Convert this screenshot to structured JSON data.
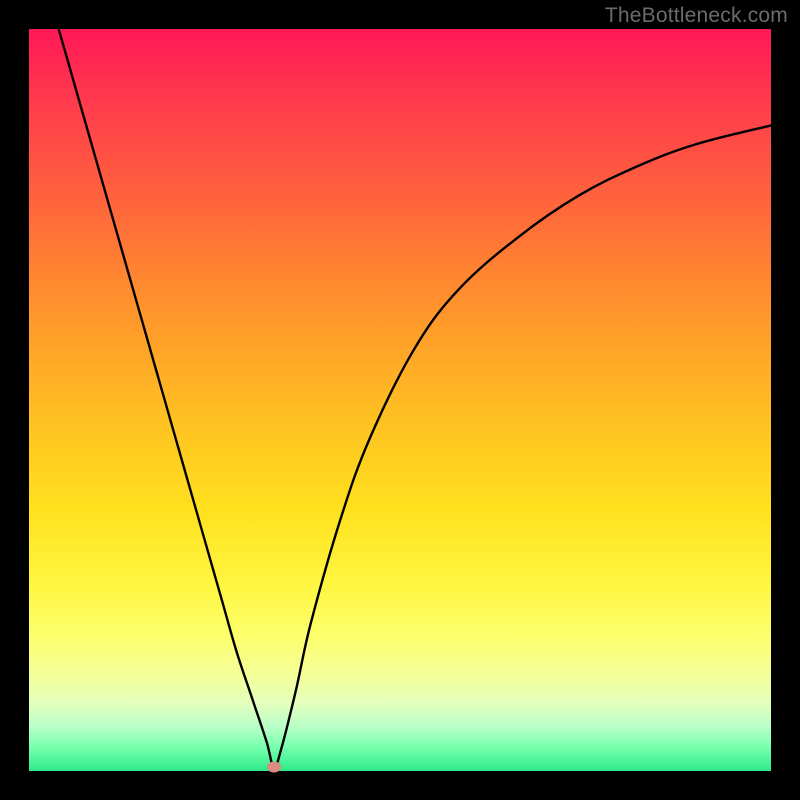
{
  "watermark": "TheBottleneck.com",
  "chart_data": {
    "type": "line",
    "title": "",
    "xlabel": "",
    "ylabel": "",
    "xlim": [
      0,
      100
    ],
    "ylim": [
      0,
      100
    ],
    "series": [
      {
        "name": "bottleneck-curve",
        "x": [
          4,
          6,
          8,
          10,
          12,
          14,
          16,
          18,
          20,
          22,
          24,
          26,
          28,
          30,
          32,
          33,
          34,
          36,
          38,
          42,
          46,
          52,
          58,
          66,
          74,
          82,
          90,
          100
        ],
        "y": [
          100,
          93,
          86,
          79,
          72,
          65,
          58,
          51,
          44,
          37,
          30,
          23,
          16,
          10,
          4,
          0.5,
          3,
          11,
          20,
          34,
          45,
          57,
          65,
          72,
          77.5,
          81.5,
          84.5,
          87
        ]
      }
    ],
    "marker": {
      "x": 33,
      "y": 0.5,
      "color": "#d98c82"
    },
    "gradient_stops": [
      {
        "pos": 0,
        "color": "#ff1857"
      },
      {
        "pos": 25,
        "color": "#ff6a3a"
      },
      {
        "pos": 52,
        "color": "#ffbf22"
      },
      {
        "pos": 75,
        "color": "#fff641"
      },
      {
        "pos": 97,
        "color": "#73ffac"
      },
      {
        "pos": 100,
        "color": "#2fe98a"
      }
    ]
  }
}
